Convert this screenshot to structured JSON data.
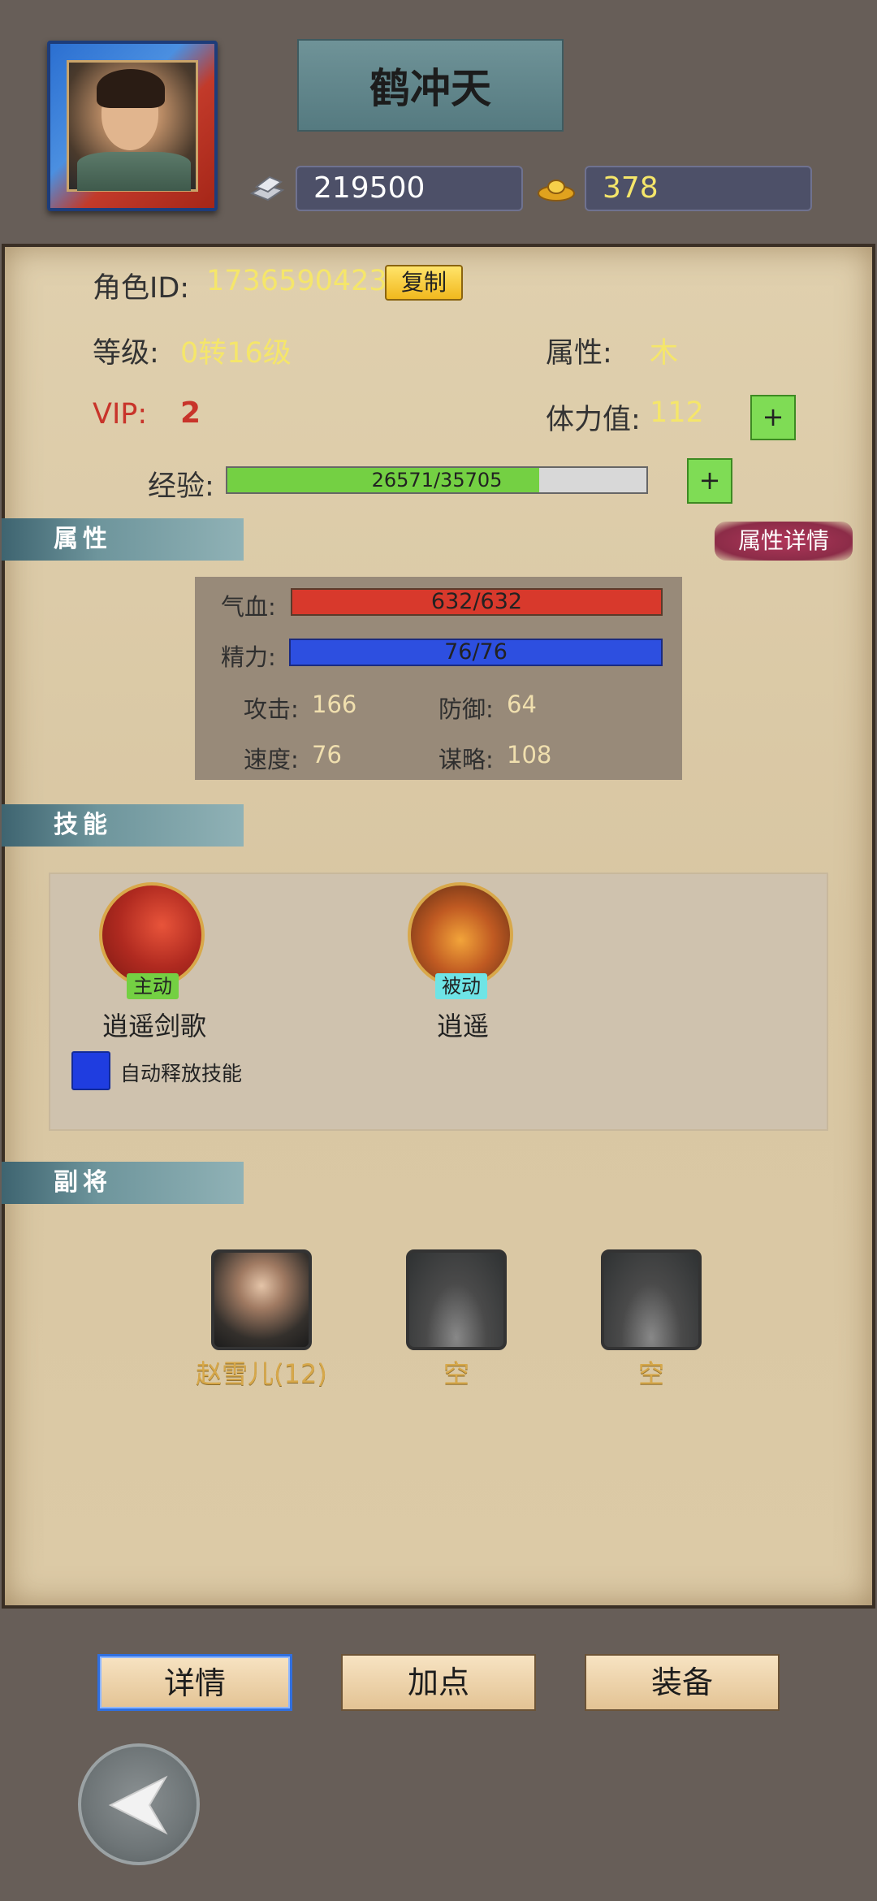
{
  "header": {
    "player_name": "鹤冲天",
    "silver_amount": "219500",
    "gold_amount": "378"
  },
  "info": {
    "role_id_label": "角色ID:",
    "role_id_value": "1736590423",
    "copy_label": "复制",
    "level_label": "等级:",
    "level_value": "0转16级",
    "element_label": "属性:",
    "element_value": "木",
    "vip_label": "VIP:",
    "vip_value": "2",
    "stamina_label": "体力值:",
    "stamina_value": "112",
    "exp_label": "经验:",
    "exp_text": "26571/35705",
    "exp_current": 26571,
    "exp_max": 35705,
    "plus_label": "+"
  },
  "attributes": {
    "section_title": "属性",
    "detail_button": "属性详情",
    "hp_label": "气血:",
    "hp_text": "632/632",
    "mp_label": "精力:",
    "mp_text": "76/76",
    "attack_label": "攻击:",
    "attack_value": "166",
    "defense_label": "防御:",
    "defense_value": "64",
    "speed_label": "速度:",
    "speed_value": "76",
    "strategy_label": "谋略:",
    "strategy_value": "108"
  },
  "skills": {
    "section_title": "技能",
    "items": [
      {
        "tag": "主动",
        "name": "逍遥剑歌"
      },
      {
        "tag": "被动",
        "name": "逍遥"
      }
    ],
    "auto_cast_label": "自动释放技能"
  },
  "deputies": {
    "section_title": "副将",
    "items": [
      {
        "name": "赵雪儿(12)"
      },
      {
        "name": "空"
      },
      {
        "name": "空"
      }
    ]
  },
  "bottom": {
    "detail_label": "详情",
    "points_label": "加点",
    "equip_label": "装备"
  },
  "colors": {
    "background": "#675e58",
    "highlight_yellow": "#f5e66a",
    "vip_red": "#c8342a",
    "hp_red": "#d8392c",
    "mp_blue": "#2d4fe0",
    "exp_green": "#74d043"
  }
}
